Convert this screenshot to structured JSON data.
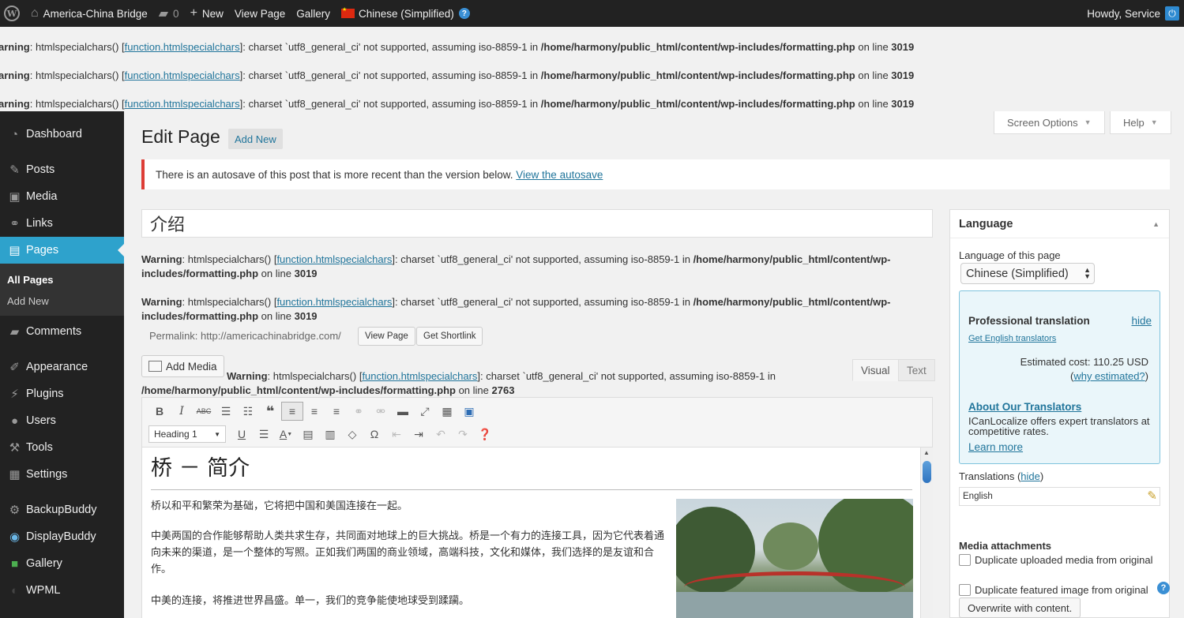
{
  "adminbar": {
    "site_name": "America-China Bridge",
    "comments_count": "0",
    "new_label": "New",
    "view_page": "View Page",
    "gallery": "Gallery",
    "language": "Chinese (Simplified)",
    "howdy": "Howdy, Service"
  },
  "top_warnings": [
    {
      "prefix": "arning",
      "fn": "function.htmlspecialchars",
      "msg": "]: charset `utf8_general_ci' not supported, assuming iso-8859-1 in ",
      "path": "/home/harmony/public_html/content/wp-includes/formatting.php",
      "online": " on line ",
      "line": "3019",
      "label": "W",
      "call": ": htmlspecialchars() ["
    },
    {
      "prefix": "arning",
      "fn": "function.htmlspecialchars",
      "msg": "]: charset `utf8_general_ci' not supported, assuming iso-8859-1 in ",
      "path": "/home/harmony/public_html/content/wp-includes/formatting.php",
      "online": " on line ",
      "line": "3019",
      "call": ": htmlspecialchars() ["
    },
    {
      "prefix": "arning",
      "fn": "function.htmlspecialchars",
      "msg": "]: charset `utf8_general_ci' not supported, assuming iso-8859-1 in ",
      "path": "/home/harmony/public_html/content/wp-includes/formatting.php",
      "online": " on line ",
      "line": "3019",
      "call": ": htmlspecialchars() ["
    }
  ],
  "sidebar": {
    "items": [
      {
        "label": "Dashboard",
        "icon": "dashboard-icon"
      },
      {
        "label": "Posts",
        "icon": "pin-icon"
      },
      {
        "label": "Media",
        "icon": "media-icon"
      },
      {
        "label": "Links",
        "icon": "link-icon"
      },
      {
        "label": "Pages",
        "icon": "page-icon"
      },
      {
        "label": "Comments",
        "icon": "comment-icon"
      },
      {
        "label": "Appearance",
        "icon": "brush-icon"
      },
      {
        "label": "Plugins",
        "icon": "plug-icon"
      },
      {
        "label": "Users",
        "icon": "user-icon"
      },
      {
        "label": "Tools",
        "icon": "wrench-icon"
      },
      {
        "label": "Settings",
        "icon": "settings-icon"
      },
      {
        "label": "BackupBuddy",
        "icon": "gear-icon"
      },
      {
        "label": "DisplayBuddy",
        "icon": "eye-icon"
      },
      {
        "label": "Gallery",
        "icon": "gallery-icon"
      },
      {
        "label": "WPML",
        "icon": "wpml-icon"
      }
    ],
    "sub": {
      "all_pages": "All Pages",
      "add_new": "Add New"
    }
  },
  "header": {
    "title": "Edit Page",
    "add_new": "Add New",
    "screen_options": "Screen Options",
    "help": "Help"
  },
  "notice": {
    "text": "There is an autosave of this post that is more recent than the version below. ",
    "link": "View the autosave"
  },
  "post_title": "介绍",
  "mid_warning": {
    "label": "Warning",
    "call": ": htmlspecialchars() [",
    "fn": "function.htmlspecialchars",
    "msg": "]: charset `utf8_general_ci' not supported, assuming iso-8859-1 in ",
    "path": "/home/harmony/public_html/content/wp-includes/formatting.php",
    "online": " on line ",
    "line": "3019",
    "line2": "2763"
  },
  "permalink": {
    "label": "Permalink: http://americachinabridge.com/",
    "view_page": "View Page",
    "shortlink": "Get Shortlink"
  },
  "editor": {
    "add_media": "Add Media",
    "visual": "Visual",
    "text": "Text",
    "format": "Heading 1",
    "heading": "桥 － 简介",
    "p1": "桥以和平和繁荣为基础，它将把中国和美国连接在一起。",
    "p2": "中美两国的合作能够帮助人类共求生存，共同面对地球上的巨大挑战。桥是一个有力的连接工具，因为它代表着通向未来的渠道，是一个整体的写照。正如我们两国的商业领域，高端科技，文化和媒体，我们选择的是友谊和合作。",
    "p3": "中美的连接，将推进世界昌盛。单一，我们的竞争能使地球受到蹂躏。"
  },
  "language_box": {
    "title": "Language",
    "lang_of_page": "Language of this page",
    "selected_lang": "Chinese (Simplified)",
    "pro_title": "Professional translation",
    "hide": "hide",
    "get_translators": "Get English translators",
    "cost": "Estimated cost: 110.25 USD",
    "why_open": "(",
    "why": "why estimated?",
    "why_close": ")",
    "about": "About Our Translators",
    "desc": "ICanLocalize offers expert translators at competitive rates.",
    "learn": "Learn more",
    "translations": "Translations (",
    "trans_hide": "hide",
    "trans_close": ")",
    "english": "English",
    "media_attachments": "Media attachments",
    "dup_uploaded": "Duplicate uploaded media from original",
    "dup_featured": "Duplicate featured image from original",
    "overwrite": "Overwrite with content."
  }
}
